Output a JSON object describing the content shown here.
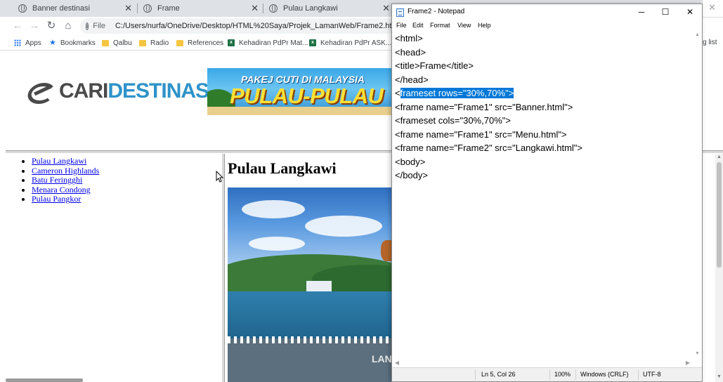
{
  "browser": {
    "tabs": [
      {
        "title": "Banner destinasi"
      },
      {
        "title": "Frame"
      },
      {
        "title": "Pulau Langkawi"
      }
    ],
    "toolbar": {
      "scheme_label": "File",
      "url": "C:/Users/nurfa/OneDrive/Desktop/HTML%20Saya/Projek_LamanWeb/Frame2.html"
    },
    "bookmarks": [
      {
        "label": "Apps",
        "icon": "apps-grid-icon"
      },
      {
        "label": "Bookmarks",
        "icon": "star-icon"
      },
      {
        "label": "Qalbu",
        "icon": "folder-icon"
      },
      {
        "label": "Radio",
        "icon": "folder-icon"
      },
      {
        "label": "References",
        "icon": "folder-icon"
      },
      {
        "label": "Kehadiran PdPr Mat...",
        "icon": "excel-icon"
      },
      {
        "label": "Kehadiran PdPr ASK...",
        "icon": "excel-icon"
      }
    ],
    "bookmarks_overflow_text": "g list"
  },
  "page": {
    "logo": {
      "part1": "CARI",
      "part2": "DESTINASI"
    },
    "ad": {
      "line1": "PAKEJ CUTI DI MALAYSIA",
      "line2": "PULAU-PULAU"
    },
    "menu": [
      "Pulau Langkawi",
      "Cameron Highlands",
      "Batu Feringghi",
      "Menara Condong",
      "Pulau Pangkor"
    ],
    "content_title": "Pulau Langkawi",
    "photo_text": "LANG"
  },
  "notepad": {
    "title": "Frame2 - Notepad",
    "menu": [
      "File",
      "Edit",
      "Format",
      "View",
      "Help"
    ],
    "lines": [
      "<html>",
      "<head>",
      "<title>Frame</title>",
      "</head>",
      "<frameset rows=\"30%,70%\">",
      "<frame name=\"Frame1\" src=\"Banner.html\">",
      "<frameset cols=\"30%,70%\">",
      "<frame name=\"Frame1\" src=\"Menu.html\">",
      "<frame name=\"Frame2\" src=\"Langkawi.html\">",
      "<body>",
      "</body>"
    ],
    "line5_prefix": "<",
    "line5_selected": "frameset rows=\"30%,70%\">",
    "status": {
      "position": "Ln 5, Col 26",
      "zoom": "100%",
      "line_ending": "Windows (CRLF)",
      "encoding": "UTF-8"
    }
  },
  "colors": {
    "selection": "#0078d7",
    "link": "#0000ee",
    "logo_blue": "#2e93c9",
    "logo_gray": "#4a4a4a"
  }
}
